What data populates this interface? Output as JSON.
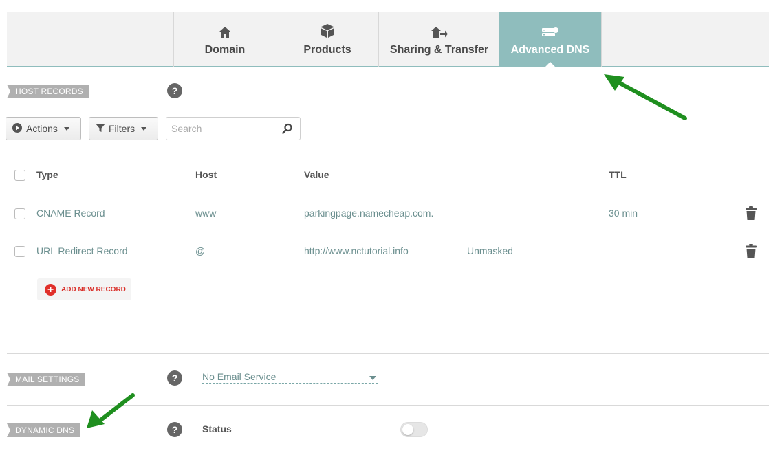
{
  "tabs": [
    {
      "label": "Domain",
      "icon": "home-icon",
      "active": false
    },
    {
      "label": "Products",
      "icon": "box-icon",
      "active": false
    },
    {
      "label": "Sharing & Transfer",
      "icon": "house-transfer-icon",
      "active": false
    },
    {
      "label": "Advanced DNS",
      "icon": "server-icon",
      "active": true
    }
  ],
  "host_records": {
    "section_label": "Host Records",
    "help": "?",
    "actions_label": "Actions",
    "filters_label": "Filters",
    "search_placeholder": "Search",
    "columns": {
      "type": "Type",
      "host": "Host",
      "value": "Value",
      "ttl": "TTL"
    },
    "rows": [
      {
        "type": "CNAME Record",
        "host": "www",
        "value": "parkingpage.namecheap.com.",
        "extra": "",
        "ttl": "30 min"
      },
      {
        "type": "URL Redirect Record",
        "host": "@",
        "value": "http://www.nctutorial.info",
        "extra": "Unmasked",
        "ttl": ""
      }
    ],
    "add_new_record": "Add New Record"
  },
  "mail_settings": {
    "section_label": "Mail Settings",
    "help": "?",
    "selected": "No Email Service"
  },
  "dynamic_dns": {
    "section_label": "Dynamic DNS",
    "help": "?",
    "status_label": "Status",
    "enabled": false
  },
  "colors": {
    "accent_teal": "#8fbdbd",
    "annotation_arrow": "#1f8f1f",
    "add_red": "#e0302a"
  }
}
